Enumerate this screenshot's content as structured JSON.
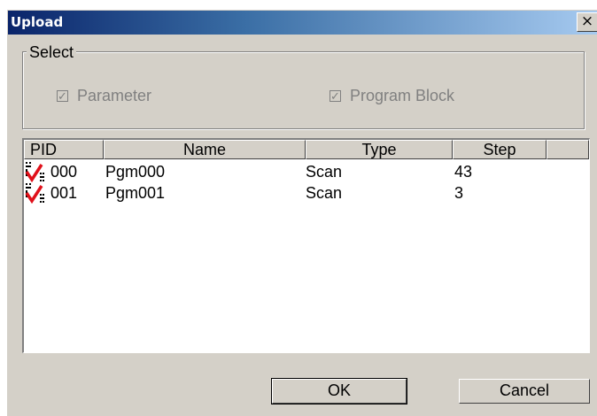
{
  "window": {
    "title": "Upload",
    "close_glyph": "×"
  },
  "select_group": {
    "legend": "Select",
    "options": [
      {
        "label": "Parameter",
        "checked": true,
        "enabled": false
      },
      {
        "label": "Program Block",
        "checked": true,
        "enabled": false
      }
    ]
  },
  "table": {
    "columns": [
      "PID",
      "Name",
      "Type",
      "Step",
      ""
    ],
    "rows": [
      {
        "pid": "000",
        "name": "Pgm000",
        "type": "Scan",
        "step": "43",
        "icon": "program-checked-icon"
      },
      {
        "pid": "001",
        "name": "Pgm001",
        "type": "Scan",
        "step": "3",
        "icon": "program-checked-icon"
      }
    ]
  },
  "buttons": {
    "ok": "OK",
    "cancel": "Cancel"
  }
}
